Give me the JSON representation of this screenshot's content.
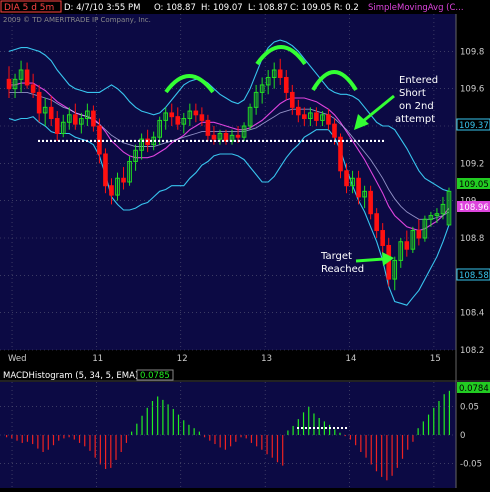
{
  "header": {
    "symbol": "DIA 5 d 5m",
    "date": "D: 4/7/10 3:55 PM",
    "open": "O: 108.87",
    "high": "H: 109.07",
    "low": "L: 108.87",
    "close": "C: 109.05",
    "range": "R: 0.2",
    "study": "SimpleMovingAvg (C...",
    "copyright": "2009 © TD AMERITRADE IP Company, Inc."
  },
  "colors": {
    "background": "#000000",
    "plot_bg": "#0c0a44",
    "grid": "#5a5a78",
    "up_candle": "#22dd22",
    "down_candle": "#ff1111",
    "bollinger": "#38c4ee",
    "sma": "#dd44dd",
    "sma_slow": "#ccccff",
    "annotation": "#33ff33",
    "support_line": "#ffffff",
    "macd_pos": "#22ee22",
    "macd_neg": "#ee2222"
  },
  "annotations": {
    "entry_line1": "Entered",
    "entry_line2": "Short",
    "entry_line3": "on 2nd",
    "entry_line4": "attempt",
    "target_line1": "Target",
    "target_line2": "Reached"
  },
  "price_badges": {
    "upper_band": "109.37",
    "last": "109.05",
    "sma": "108.96",
    "lower_band": "108.58"
  },
  "macd": {
    "title": "MACDHistogram (5, 34, 5, EMA)",
    "value": "0.0785",
    "badge": "0.0784"
  },
  "chart_data": [
    {
      "type": "candlestick",
      "title": "DIA 5 d 5m",
      "xlabel": "",
      "ylabel": "",
      "x_tick_labels": [
        "Wed",
        "11",
        "12",
        "13",
        "14",
        "15"
      ],
      "ylim": [
        108.2,
        110.0
      ],
      "y_ticks": [
        108.2,
        108.4,
        108.6,
        108.8,
        109.0,
        109.2,
        109.4,
        109.6,
        109.8
      ],
      "y_tick_labels": [
        "108.2",
        "108.4",
        "108.6",
        "108.8",
        "109",
        "109.2",
        "109.4",
        "109.6",
        "109.8"
      ],
      "grid": true,
      "support_level": 109.32,
      "candles": [
        {
          "o": 109.65,
          "h": 109.72,
          "l": 109.55,
          "c": 109.6
        },
        {
          "o": 109.6,
          "h": 109.68,
          "l": 109.55,
          "c": 109.65
        },
        {
          "o": 109.65,
          "h": 109.75,
          "l": 109.58,
          "c": 109.7
        },
        {
          "o": 109.7,
          "h": 109.74,
          "l": 109.6,
          "c": 109.62
        },
        {
          "o": 109.62,
          "h": 109.68,
          "l": 109.55,
          "c": 109.58
        },
        {
          "o": 109.58,
          "h": 109.62,
          "l": 109.42,
          "c": 109.47
        },
        {
          "o": 109.47,
          "h": 109.55,
          "l": 109.4,
          "c": 109.5
        },
        {
          "o": 109.5,
          "h": 109.56,
          "l": 109.4,
          "c": 109.44
        },
        {
          "o": 109.44,
          "h": 109.48,
          "l": 109.32,
          "c": 109.36
        },
        {
          "o": 109.36,
          "h": 109.46,
          "l": 109.34,
          "c": 109.42
        },
        {
          "o": 109.42,
          "h": 109.5,
          "l": 109.38,
          "c": 109.46
        },
        {
          "o": 109.46,
          "h": 109.52,
          "l": 109.38,
          "c": 109.41
        },
        {
          "o": 109.41,
          "h": 109.47,
          "l": 109.36,
          "c": 109.44
        },
        {
          "o": 109.44,
          "h": 109.52,
          "l": 109.4,
          "c": 109.48
        },
        {
          "o": 109.48,
          "h": 109.51,
          "l": 109.37,
          "c": 109.4
        },
        {
          "o": 109.4,
          "h": 109.44,
          "l": 109.2,
          "c": 109.25
        },
        {
          "o": 109.25,
          "h": 109.28,
          "l": 109.04,
          "c": 109.08
        },
        {
          "o": 109.08,
          "h": 109.12,
          "l": 108.98,
          "c": 109.03
        },
        {
          "o": 109.03,
          "h": 109.15,
          "l": 109.0,
          "c": 109.12
        },
        {
          "o": 109.12,
          "h": 109.18,
          "l": 109.06,
          "c": 109.1
        },
        {
          "o": 109.1,
          "h": 109.24,
          "l": 109.08,
          "c": 109.21
        },
        {
          "o": 109.21,
          "h": 109.3,
          "l": 109.16,
          "c": 109.27
        },
        {
          "o": 109.27,
          "h": 109.36,
          "l": 109.22,
          "c": 109.33
        },
        {
          "o": 109.33,
          "h": 109.38,
          "l": 109.26,
          "c": 109.3
        },
        {
          "o": 109.3,
          "h": 109.37,
          "l": 109.27,
          "c": 109.34
        },
        {
          "o": 109.34,
          "h": 109.45,
          "l": 109.3,
          "c": 109.43
        },
        {
          "o": 109.43,
          "h": 109.5,
          "l": 109.38,
          "c": 109.47
        },
        {
          "o": 109.47,
          "h": 109.52,
          "l": 109.4,
          "c": 109.45
        },
        {
          "o": 109.45,
          "h": 109.5,
          "l": 109.38,
          "c": 109.41
        },
        {
          "o": 109.41,
          "h": 109.47,
          "l": 109.36,
          "c": 109.44
        },
        {
          "o": 109.44,
          "h": 109.52,
          "l": 109.4,
          "c": 109.48
        },
        {
          "o": 109.48,
          "h": 109.52,
          "l": 109.42,
          "c": 109.46
        },
        {
          "o": 109.46,
          "h": 109.5,
          "l": 109.4,
          "c": 109.43
        },
        {
          "o": 109.43,
          "h": 109.46,
          "l": 109.32,
          "c": 109.35
        },
        {
          "o": 109.35,
          "h": 109.4,
          "l": 109.3,
          "c": 109.33
        },
        {
          "o": 109.33,
          "h": 109.38,
          "l": 109.3,
          "c": 109.36
        },
        {
          "o": 109.36,
          "h": 109.38,
          "l": 109.3,
          "c": 109.32
        },
        {
          "o": 109.32,
          "h": 109.38,
          "l": 109.3,
          "c": 109.35
        },
        {
          "o": 109.35,
          "h": 109.4,
          "l": 109.31,
          "c": 109.34
        },
        {
          "o": 109.34,
          "h": 109.42,
          "l": 109.32,
          "c": 109.4
        },
        {
          "o": 109.4,
          "h": 109.52,
          "l": 109.38,
          "c": 109.5
        },
        {
          "o": 109.5,
          "h": 109.62,
          "l": 109.46,
          "c": 109.58
        },
        {
          "o": 109.58,
          "h": 109.66,
          "l": 109.52,
          "c": 109.62
        },
        {
          "o": 109.62,
          "h": 109.7,
          "l": 109.57,
          "c": 109.66
        },
        {
          "o": 109.66,
          "h": 109.74,
          "l": 109.6,
          "c": 109.7
        },
        {
          "o": 109.7,
          "h": 109.76,
          "l": 109.62,
          "c": 109.66
        },
        {
          "o": 109.66,
          "h": 109.7,
          "l": 109.54,
          "c": 109.58
        },
        {
          "o": 109.58,
          "h": 109.62,
          "l": 109.46,
          "c": 109.5
        },
        {
          "o": 109.5,
          "h": 109.54,
          "l": 109.42,
          "c": 109.46
        },
        {
          "o": 109.46,
          "h": 109.5,
          "l": 109.4,
          "c": 109.44
        },
        {
          "o": 109.44,
          "h": 109.5,
          "l": 109.4,
          "c": 109.47
        },
        {
          "o": 109.47,
          "h": 109.5,
          "l": 109.4,
          "c": 109.43
        },
        {
          "o": 109.43,
          "h": 109.48,
          "l": 109.4,
          "c": 109.46
        },
        {
          "o": 109.46,
          "h": 109.49,
          "l": 109.38,
          "c": 109.41
        },
        {
          "o": 109.41,
          "h": 109.44,
          "l": 109.3,
          "c": 109.34
        },
        {
          "o": 109.34,
          "h": 109.36,
          "l": 109.12,
          "c": 109.16
        },
        {
          "o": 109.16,
          "h": 109.2,
          "l": 109.04,
          "c": 109.08
        },
        {
          "o": 109.08,
          "h": 109.16,
          "l": 109.04,
          "c": 109.12
        },
        {
          "o": 109.12,
          "h": 109.16,
          "l": 108.98,
          "c": 109.02
        },
        {
          "o": 109.02,
          "h": 109.08,
          "l": 108.96,
          "c": 109.05
        },
        {
          "o": 109.05,
          "h": 109.08,
          "l": 108.9,
          "c": 108.93
        },
        {
          "o": 108.93,
          "h": 108.96,
          "l": 108.8,
          "c": 108.84
        },
        {
          "o": 108.84,
          "h": 108.88,
          "l": 108.72,
          "c": 108.76
        },
        {
          "o": 108.76,
          "h": 108.8,
          "l": 108.54,
          "c": 108.58
        },
        {
          "o": 108.58,
          "h": 108.7,
          "l": 108.52,
          "c": 108.68
        },
        {
          "o": 108.68,
          "h": 108.8,
          "l": 108.64,
          "c": 108.78
        },
        {
          "o": 108.78,
          "h": 108.84,
          "l": 108.7,
          "c": 108.74
        },
        {
          "o": 108.74,
          "h": 108.86,
          "l": 108.72,
          "c": 108.84
        },
        {
          "o": 108.84,
          "h": 108.9,
          "l": 108.76,
          "c": 108.8
        },
        {
          "o": 108.8,
          "h": 108.92,
          "l": 108.78,
          "c": 108.9
        },
        {
          "o": 108.9,
          "h": 108.94,
          "l": 108.86,
          "c": 108.92
        },
        {
          "o": 108.92,
          "h": 108.96,
          "l": 108.88,
          "c": 108.93
        },
        {
          "o": 108.93,
          "h": 109.02,
          "l": 108.9,
          "c": 108.98
        },
        {
          "o": 108.87,
          "h": 109.07,
          "l": 108.87,
          "c": 109.05
        }
      ],
      "series": [
        {
          "name": "SimpleMovingAvg",
          "values": [
            109.62,
            109.62,
            109.63,
            109.63,
            109.63,
            109.61,
            109.59,
            109.56,
            109.53,
            109.51,
            109.49,
            109.47,
            109.46,
            109.45,
            109.44,
            109.41,
            109.37,
            109.32,
            109.29,
            109.26,
            109.24,
            109.23,
            109.23,
            109.23,
            109.24,
            109.26,
            109.28,
            109.31,
            109.33,
            109.35,
            109.38,
            109.4,
            109.42,
            109.42,
            109.42,
            109.41,
            109.4,
            109.39,
            109.38,
            109.38,
            109.39,
            109.41,
            109.43,
            109.46,
            109.49,
            109.52,
            109.54,
            109.55,
            109.55,
            109.55,
            109.54,
            109.53,
            109.51,
            109.49,
            109.46,
            109.42,
            109.37,
            109.32,
            109.27,
            109.22,
            109.16,
            109.1,
            109.04,
            108.97,
            108.92,
            108.89,
            108.86,
            108.85,
            108.84,
            108.85,
            108.87,
            108.89,
            108.92,
            108.96
          ]
        },
        {
          "name": "UpperBand",
          "values": [
            109.8,
            109.81,
            109.82,
            109.82,
            109.81,
            109.8,
            109.78,
            109.75,
            109.7,
            109.66,
            109.62,
            109.6,
            109.59,
            109.58,
            109.58,
            109.58,
            109.6,
            109.62,
            109.6,
            109.57,
            109.53,
            109.5,
            109.48,
            109.47,
            109.46,
            109.47,
            109.5,
            109.54,
            109.58,
            109.62,
            109.64,
            109.65,
            109.65,
            109.63,
            109.6,
            109.57,
            109.55,
            109.53,
            109.52,
            109.54,
            109.6,
            109.68,
            109.76,
            109.82,
            109.85,
            109.86,
            109.85,
            109.83,
            109.8,
            109.76,
            109.72,
            109.68,
            109.64,
            109.6,
            109.58,
            109.57,
            109.57,
            109.56,
            109.54,
            109.5,
            109.46,
            109.42,
            109.4,
            109.4,
            109.38,
            109.33,
            109.28,
            109.22,
            109.16,
            109.12,
            109.1,
            109.08,
            109.06,
            109.05
          ]
        },
        {
          "name": "LowerBand",
          "values": [
            109.44,
            109.43,
            109.44,
            109.44,
            109.45,
            109.42,
            109.4,
            109.37,
            109.36,
            109.36,
            109.36,
            109.34,
            109.33,
            109.32,
            109.3,
            109.24,
            109.14,
            109.02,
            108.98,
            108.95,
            108.95,
            108.96,
            108.98,
            108.99,
            109.02,
            109.05,
            109.06,
            109.08,
            109.08,
            109.08,
            109.12,
            109.15,
            109.19,
            109.21,
            109.24,
            109.25,
            109.25,
            109.25,
            109.24,
            109.22,
            109.18,
            109.14,
            109.1,
            109.1,
            109.13,
            109.18,
            109.23,
            109.27,
            109.3,
            109.34,
            109.36,
            109.38,
            109.38,
            109.38,
            109.34,
            109.27,
            109.17,
            109.08,
            109.0,
            108.94,
            108.86,
            108.78,
            108.68,
            108.54,
            108.46,
            108.45,
            108.44,
            108.48,
            108.52,
            108.58,
            108.64,
            108.7,
            108.78,
            108.87
          ]
        },
        {
          "name": "SlowAvg",
          "values": [
            109.58,
            109.58,
            109.58,
            109.58,
            109.57,
            109.56,
            109.55,
            109.54,
            109.52,
            109.5,
            109.49,
            109.47,
            109.46,
            109.45,
            109.43,
            109.41,
            109.38,
            109.35,
            109.33,
            109.31,
            109.3,
            109.29,
            109.29,
            109.29,
            109.29,
            109.3,
            109.31,
            109.32,
            109.33,
            109.34,
            109.35,
            109.36,
            109.37,
            109.37,
            109.37,
            109.37,
            109.37,
            109.37,
            109.37,
            109.37,
            109.38,
            109.39,
            109.41,
            109.43,
            109.45,
            109.47,
            109.48,
            109.49,
            109.49,
            109.49,
            109.49,
            109.48,
            109.47,
            109.46,
            109.44,
            109.41,
            109.38,
            109.34,
            109.3,
            109.26,
            109.22,
            109.17,
            109.12,
            109.06,
            109.01,
            108.97,
            108.94,
            108.92,
            108.9,
            108.9,
            108.9,
            108.91,
            108.92,
            108.94
          ]
        }
      ]
    },
    {
      "type": "bar",
      "title": "MACDHistogram (5, 34, 5, EMA)",
      "xlabel": "",
      "ylabel": "",
      "ylim": [
        -0.09,
        0.09
      ],
      "y_ticks": [
        -0.05,
        0,
        0.05
      ],
      "y_tick_labels": [
        "-0.05",
        "0",
        "0.05"
      ],
      "values": [
        -0.004,
        -0.006,
        -0.01,
        -0.014,
        -0.012,
        -0.016,
        -0.024,
        -0.03,
        -0.026,
        -0.018,
        -0.01,
        -0.006,
        -0.004,
        -0.008,
        -0.014,
        -0.02,
        -0.028,
        -0.04,
        -0.052,
        -0.06,
        -0.058,
        -0.044,
        -0.03,
        -0.014,
        0.006,
        0.02,
        0.034,
        0.048,
        0.06,
        0.068,
        0.062,
        0.054,
        0.046,
        0.036,
        0.026,
        0.018,
        0.012,
        0.006,
        -0.004,
        -0.01,
        -0.016,
        -0.022,
        -0.026,
        -0.02,
        -0.012,
        -0.004,
        -0.006,
        -0.014,
        -0.02,
        -0.026,
        -0.034,
        -0.04,
        -0.048,
        -0.054,
        0.008,
        0.016,
        0.028,
        0.04,
        0.05,
        0.038,
        0.03,
        0.024,
        0.018,
        0.01,
        0.004,
        -0.002,
        -0.008,
        -0.018,
        -0.03,
        -0.04,
        -0.052,
        -0.064,
        -0.074,
        -0.08,
        -0.072,
        -0.058,
        -0.042,
        -0.026,
        -0.012,
        0.012,
        0.024,
        0.036,
        0.048,
        0.06,
        0.072,
        0.078
      ]
    }
  ]
}
